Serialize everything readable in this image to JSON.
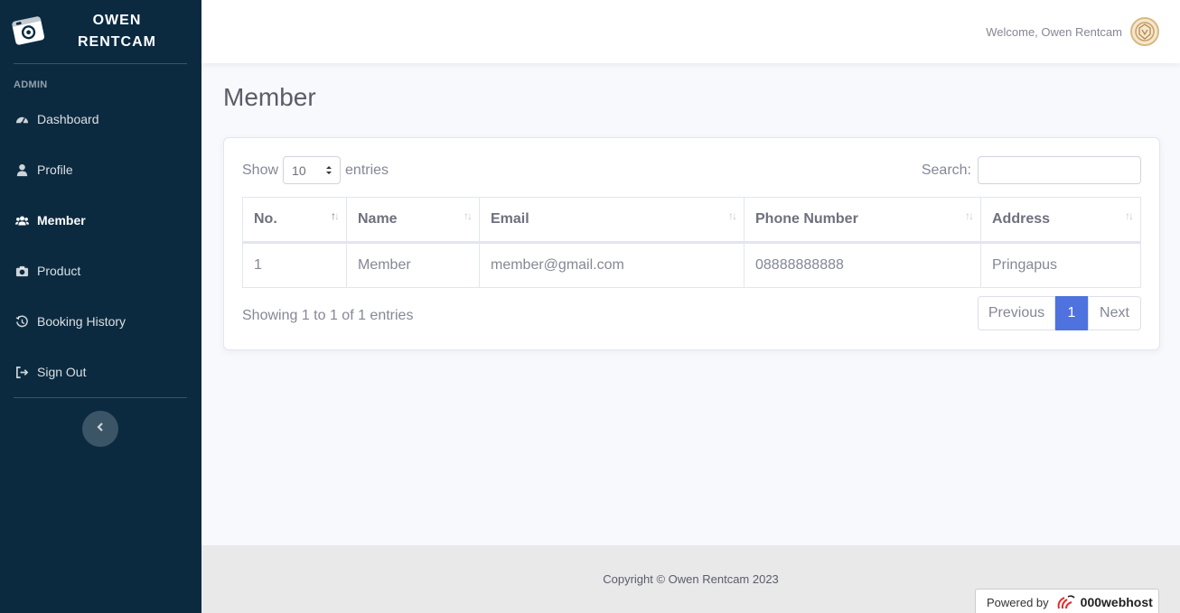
{
  "sidebar": {
    "brand": [
      "OWEN",
      "RENTCAM"
    ],
    "brand_icon": "camera-icon",
    "heading": "ADMIN",
    "items": [
      {
        "label": "Dashboard",
        "icon": "tachometer-icon"
      },
      {
        "label": "Profile",
        "icon": "user-icon"
      },
      {
        "label": "Member",
        "icon": "users-icon",
        "active": true
      },
      {
        "label": "Product",
        "icon": "camera-icon"
      },
      {
        "label": "Booking History",
        "icon": "history-icon"
      },
      {
        "label": "Sign Out",
        "icon": "sign-out-icon"
      }
    ],
    "toggle_icon": "chevron-left-icon"
  },
  "topbar": {
    "welcome": "Welcome, Owen Rentcam",
    "avatar_icon": "emblem-avatar"
  },
  "page": {
    "title": "Member"
  },
  "table_controls": {
    "show_label": "Show",
    "entries_value": "10",
    "entries_label": "entries",
    "search_label": "Search:",
    "search_value": ""
  },
  "table": {
    "columns": [
      "No.",
      "Name",
      "Email",
      "Phone Number",
      "Address"
    ],
    "rows": [
      [
        "1",
        "Member",
        "member@gmail.com",
        "08888888888",
        "Pringapus"
      ]
    ]
  },
  "pagination": {
    "info": "Showing 1 to 1 of 1 entries",
    "previous": "Previous",
    "current": "1",
    "next": "Next"
  },
  "footer": {
    "copyright": "Copyright © Owen Rentcam 2023",
    "powered_by": "Powered by",
    "host": "000webhost"
  },
  "colors": {
    "sidebar_bg": "#0b2a40",
    "accent": "#4e73df"
  }
}
